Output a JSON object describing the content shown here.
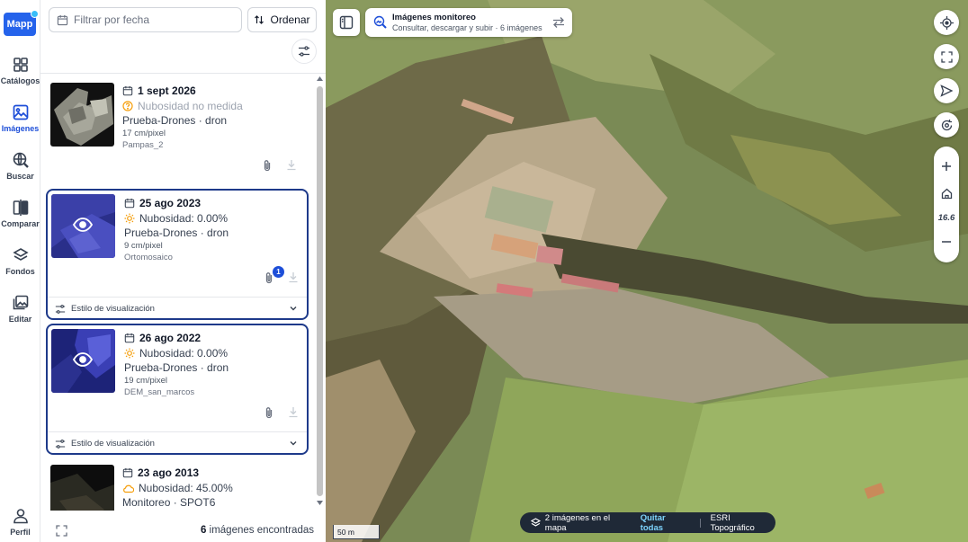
{
  "rail": {
    "logo": "Mapp",
    "items": [
      {
        "label": "Catálogos",
        "icon": "grid-icon"
      },
      {
        "label": "Imágenes",
        "icon": "image-icon"
      },
      {
        "label": "Buscar",
        "icon": "search-globe-icon"
      },
      {
        "label": "Comparar",
        "icon": "compare-icon"
      },
      {
        "label": "Fondos",
        "icon": "layers-icon"
      },
      {
        "label": "Editar",
        "icon": "edit-images-icon"
      }
    ],
    "profile": "Perfil"
  },
  "panel": {
    "filter_placeholder": "Filtrar por fecha",
    "sort_label": "Ordenar",
    "cards": [
      {
        "date": "1 sept 2026",
        "cloud": "Nubosidad no medida",
        "source": "Prueba-Drones · dron",
        "resolution": "17 cm/pixel",
        "name": "Pampas_2",
        "selected": false
      },
      {
        "date": "25 ago 2023",
        "cloud": "Nubosidad: 0.00%",
        "source": "Prueba-Drones · dron",
        "resolution": "9 cm/pixel",
        "name": "Ortomosaico",
        "selected": true,
        "attachments": "1",
        "style": "Estilo de visualización"
      },
      {
        "date": "26 ago 2022",
        "cloud": "Nubosidad: 0.00%",
        "source": "Prueba-Drones · dron",
        "resolution": "19 cm/pixel",
        "name": "DEM_san_marcos",
        "selected": true,
        "style": "Estilo de visualización"
      },
      {
        "date": "23 ago 2013",
        "cloud": "Nubosidad: 45.00%",
        "source": "Monitoreo · SPOT6",
        "selected": false
      }
    ],
    "found_count": "6",
    "found_label": "imágenes encontradas"
  },
  "map": {
    "context_title": "Imágenes monitoreo",
    "context_subtitle": "Consultar, descargar y subir · 6 imágenes",
    "zoom_level": "16.6",
    "scale": "50 m",
    "status_count": "2 imágenes en el mapa",
    "status_clear": "Quitar todas",
    "basemap": "ESRI Topográfico"
  },
  "colors": {
    "accent": "#1d4ed8",
    "selected_border": "#1e3a8a",
    "status_bg": "#1f2937"
  }
}
